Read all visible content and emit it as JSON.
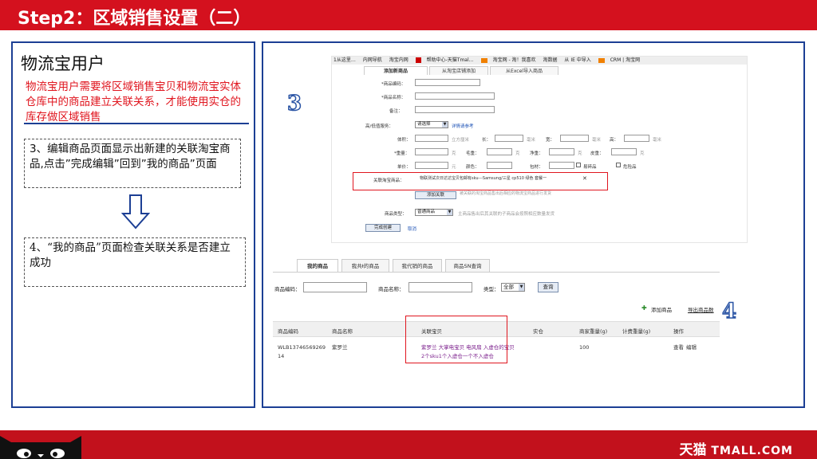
{
  "slide": {
    "title": "Step2：区域销售设置（二）",
    "left_title": "物流宝用户",
    "intro": "物流宝用户需要将区域销售宝贝和物流宝实体仓库中的商品建立关联关系，才能使用实仓的库存做区域销售",
    "step3": "3、编辑商品页面显示出新建的关联淘宝商品,点击”完成编辑”回到”我的商品”页面",
    "step4": "4、“我的商品”页面检查关联关系是否建立成功",
    "marker3": "3",
    "marker4": "4",
    "brand_cn": "天猫",
    "brand_en": "TMALL.COM"
  },
  "bookmarks": [
    "1从这里…",
    "内网导航",
    "淘宝内网",
    "帮助中心-天猫Tmal…",
    "淘宝网 - 淘！我喜欢",
    "淘数据",
    "从 IE 中导入",
    "CRM | 淘宝网"
  ],
  "edit_form": {
    "tabs": [
      "添加新商品",
      "从淘宝店铺添加",
      "从Excel导入商品"
    ],
    "labels": {
      "code": "*商品编码：",
      "name": "*商品名称：",
      "remark": "备注：",
      "service": "高/低值服务：",
      "volume": "体积：",
      "weight": "*重量：",
      "price": "单价：",
      "link": "关联淘宝商品：",
      "type": "商品类型："
    },
    "service_select": "请选择",
    "service_hint": "详情请参考",
    "dims": {
      "unit_cm3": "立方厘米",
      "length": "长：",
      "width": "宽：",
      "height": "高：",
      "mm": "毫米"
    },
    "weights": {
      "unit_g": "克",
      "gross": "毛重：",
      "net": "净重：",
      "tare": "皮重："
    },
    "price_row": {
      "unit": "元",
      "color": "颜色：",
      "pack": "包材：",
      "fragile": "易碎品",
      "danger": "危险品"
    },
    "linked_item": "物联测试次日达达宝贝包邮有sku---Samsung/三星 cp510 绿色 套餐一",
    "remove": "✕",
    "add_link_btn": "添加关联",
    "link_hint": "被关联的淘宝商品售出后相应的物流宝商品进行发货",
    "type_select": "普通商品",
    "type_hint": "主商品售出后其关联的子商品会按照相应数量发货",
    "finish_btn": "完成创建",
    "cancel": "取消"
  },
  "my_products": {
    "tabs": [
      "我的商品",
      "我共Ɨ的商品",
      "我代销的商品",
      "商品SN查询"
    ],
    "filter": {
      "code_label": "商品编码：",
      "name_label": "商品名称：",
      "type_label": "类型：",
      "type_value": "全部",
      "search_btn": "查询"
    },
    "add_btn": "添加商品",
    "export_link": "导出商品数",
    "headers": [
      "商品编码",
      "商品名称",
      "关联宝贝",
      "实仓",
      "商家重量(g)",
      "计费重量(g)",
      "操作"
    ],
    "row": {
      "code": "WLB1374656926914",
      "name": "紫罗兰",
      "linked_1": "紫罗兰 大掌电宝贝 电风扇 入虚仓的宝贝",
      "linked_2": "2个sku1个入虚仓一个不入虚仓",
      "merchant_weight": "100",
      "op_view": "查看",
      "op_edit": "编辑"
    }
  },
  "colors": {
    "brand_red": "#d4111e",
    "panel_blue": "#1c3f94",
    "highlight_red": "#e0161f"
  }
}
